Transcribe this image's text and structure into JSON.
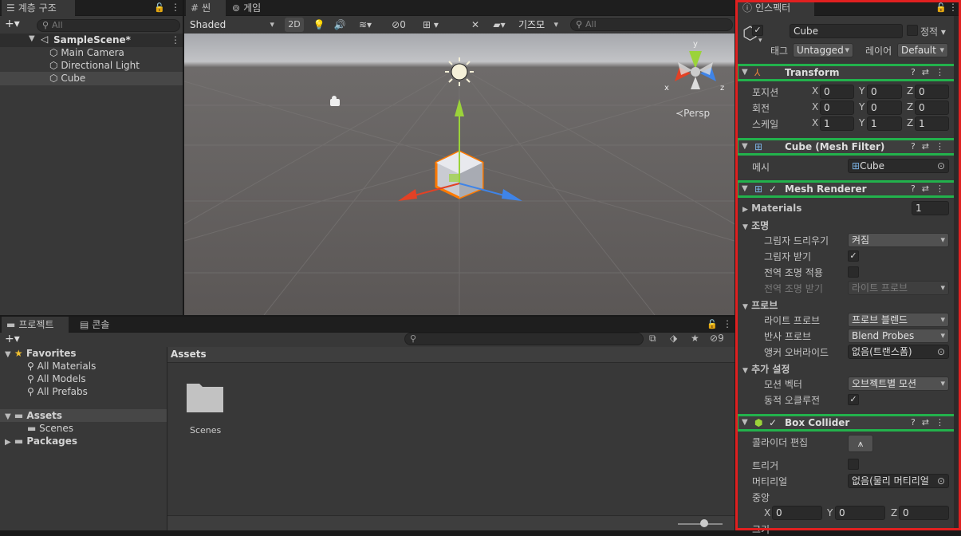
{
  "hierarchy": {
    "tab": "계층 구조",
    "search_placeholder": "All",
    "scene": "SampleScene*",
    "items": [
      "Main Camera",
      "Directional Light",
      "Cube"
    ]
  },
  "scene_view": {
    "tabs": [
      "씬",
      "게임"
    ],
    "shading": "Shaded",
    "mode_2d": "2D",
    "hidden_count": "0",
    "gizmos": "기즈모",
    "search_placeholder": "All",
    "persp_label": "Persp",
    "axis_labels": {
      "x": "x",
      "y": "y",
      "z": "z"
    }
  },
  "project": {
    "tabs": [
      "프로젝트",
      "콘솔"
    ],
    "favorites_label": "Favorites",
    "favorites": [
      "All Materials",
      "All Models",
      "All Prefabs"
    ],
    "assets_label": "Assets",
    "scenes_label": "Scenes",
    "packages_label": "Packages",
    "breadcrumb": "Assets",
    "folder_name": "Scenes",
    "hidden_packages": "9"
  },
  "inspector": {
    "tab": "인스펙터",
    "object_name": "Cube",
    "static_label": "정적",
    "tag_label": "태그",
    "tag_value": "Untagged",
    "layer_label": "레이어",
    "layer_value": "Default",
    "transform": {
      "title": "Transform",
      "position_label": "포지션",
      "rotation_label": "회전",
      "scale_label": "스케일",
      "position": {
        "x": "0",
        "y": "0",
        "z": "0"
      },
      "rotation": {
        "x": "0",
        "y": "0",
        "z": "0"
      },
      "scale": {
        "x": "1",
        "y": "1",
        "z": "1"
      }
    },
    "mesh_filter": {
      "title": "Cube (Mesh Filter)",
      "mesh_label": "메시",
      "mesh_value": "Cube"
    },
    "mesh_renderer": {
      "title": "Mesh Renderer",
      "materials_label": "Materials",
      "materials_count": "1",
      "lighting_label": "조명",
      "cast_shadows_label": "그림자 드리우기",
      "cast_shadows_value": "켜짐",
      "receive_shadows_label": "그림자 받기",
      "contribute_gi_label": "전역 조명 적용",
      "receive_gi_label": "전역 조명 받기",
      "receive_gi_value": "라이트 프로브",
      "probes_label": "프로브",
      "light_probes_label": "라이트 프로브",
      "light_probes_value": "프로브 블렌드",
      "reflection_probes_label": "반사 프로브",
      "reflection_probes_value": "Blend Probes",
      "anchor_override_label": "앵커 오버라이드",
      "anchor_override_value": "없음(트랜스폼)",
      "additional_label": "추가 설정",
      "motion_vectors_label": "모션 벡터",
      "motion_vectors_value": "오브젝트별 모션",
      "dynamic_occlusion_label": "동적 오클루전"
    },
    "box_collider": {
      "title": "Box Collider",
      "edit_label": "콜라이더 편집",
      "trigger_label": "트리거",
      "material_label": "머티리얼",
      "material_value": "없음(물리 머티리얼",
      "center_label": "중앙",
      "center": {
        "x": "0",
        "y": "0",
        "z": "0"
      },
      "size_label": "크기"
    }
  },
  "colors": {
    "highlight_green": "#22b24c",
    "outline_red": "#e02020",
    "selection": "#2c5d87"
  }
}
